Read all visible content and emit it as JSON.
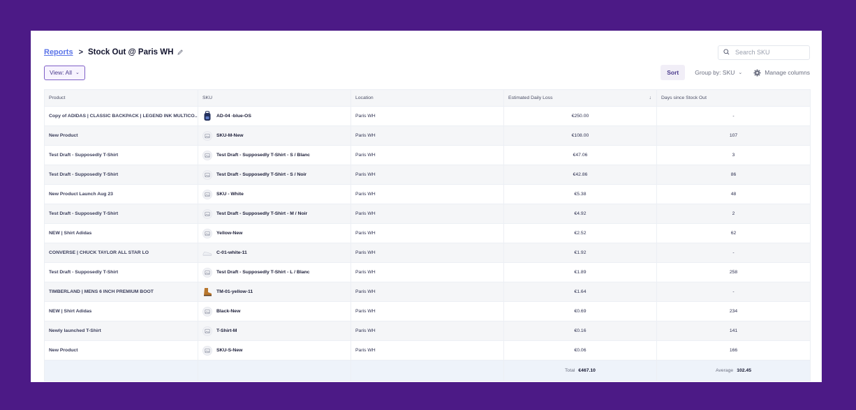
{
  "breadcrumb": {
    "parent": "Reports",
    "separator": ">",
    "title": "Stock Out @ Paris WH"
  },
  "search": {
    "placeholder": "Search SKU",
    "value": ""
  },
  "toolbar": {
    "view_label": "View: All",
    "sort_label": "Sort",
    "group_label": "Group by: SKU",
    "manage_label": "Manage columns"
  },
  "table": {
    "columns": [
      "Product",
      "SKU",
      "Location",
      "Estimated Daily Loss",
      "Days since Stock Out"
    ],
    "sorted_column": "Estimated Daily Loss",
    "sort_direction": "descending",
    "rows": [
      {
        "product": "Copy of ADIDAS | CLASSIC BACKPACK | LEGEND INK MULTICO...",
        "sku": "AD-04 -blue-OS",
        "thumb": "backpack-photo",
        "location": "Paris WH",
        "loss": "€250.00",
        "days": "-"
      },
      {
        "product": "New Product",
        "sku": "SKU-M-New",
        "thumb": "image-placeholder-icon",
        "location": "Paris WH",
        "loss": "€108.00",
        "days": "107"
      },
      {
        "product": "Test Draft - Supposedly T-Shirt",
        "sku": "Test Draft - Supposedly T-Shirt - S / Blanc",
        "thumb": "image-placeholder-icon",
        "location": "Paris WH",
        "loss": "€47.06",
        "days": "3"
      },
      {
        "product": "Test Draft - Supposedly T-Shirt",
        "sku": "Test Draft - Supposedly T-Shirt - S / Noir",
        "thumb": "image-placeholder-icon",
        "location": "Paris WH",
        "loss": "€42.86",
        "days": "86"
      },
      {
        "product": "New Product Launch Aug 23",
        "sku": "SKU - White",
        "thumb": "image-placeholder-icon",
        "location": "Paris WH",
        "loss": "€5.38",
        "days": "48"
      },
      {
        "product": "Test Draft - Supposedly T-Shirt",
        "sku": "Test Draft - Supposedly T-Shirt - M / Noir",
        "thumb": "image-placeholder-icon",
        "location": "Paris WH",
        "loss": "€4.92",
        "days": "2"
      },
      {
        "product": "NEW | Shirt Adidas",
        "sku": "Yellow-New",
        "thumb": "image-placeholder-icon",
        "location": "Paris WH",
        "loss": "€2.52",
        "days": "62"
      },
      {
        "product": "CONVERSE | CHUCK TAYLOR ALL STAR LO",
        "sku": "C-01-white-11",
        "thumb": "sneaker-photo",
        "location": "Paris WH",
        "loss": "€1.92",
        "days": "-"
      },
      {
        "product": "Test Draft - Supposedly T-Shirt",
        "sku": "Test Draft - Supposedly T-Shirt - L / Blanc",
        "thumb": "image-placeholder-icon",
        "location": "Paris WH",
        "loss": "€1.89",
        "days": "258"
      },
      {
        "product": "TIMBERLAND | MENS 6 INCH PREMIUM BOOT",
        "sku": "TM-01-yellow-11",
        "thumb": "boot-photo",
        "location": "Paris WH",
        "loss": "€1.64",
        "days": "-"
      },
      {
        "product": "NEW | Shirt Adidas",
        "sku": "Black-New",
        "thumb": "image-placeholder-icon",
        "location": "Paris WH",
        "loss": "€0.69",
        "days": "234"
      },
      {
        "product": "Newly launched T-Shirt",
        "sku": "T-Shirt-M",
        "thumb": "image-placeholder-icon",
        "location": "Paris WH",
        "loss": "€0.16",
        "days": "141"
      },
      {
        "product": "New Product",
        "sku": "SKU-S-New",
        "thumb": "image-placeholder-icon",
        "location": "Paris WH",
        "loss": "€0.06",
        "days": "166"
      }
    ],
    "footer": {
      "total_label": "Total",
      "total_value": "€467.10",
      "average_label": "Average",
      "average_value": "102.45"
    }
  },
  "colors": {
    "background": "#4c1a86",
    "accent": "#7e5fc6",
    "link": "#5b74e8",
    "row_alt": "#f5f6f8",
    "footer": "#eef3fa"
  }
}
